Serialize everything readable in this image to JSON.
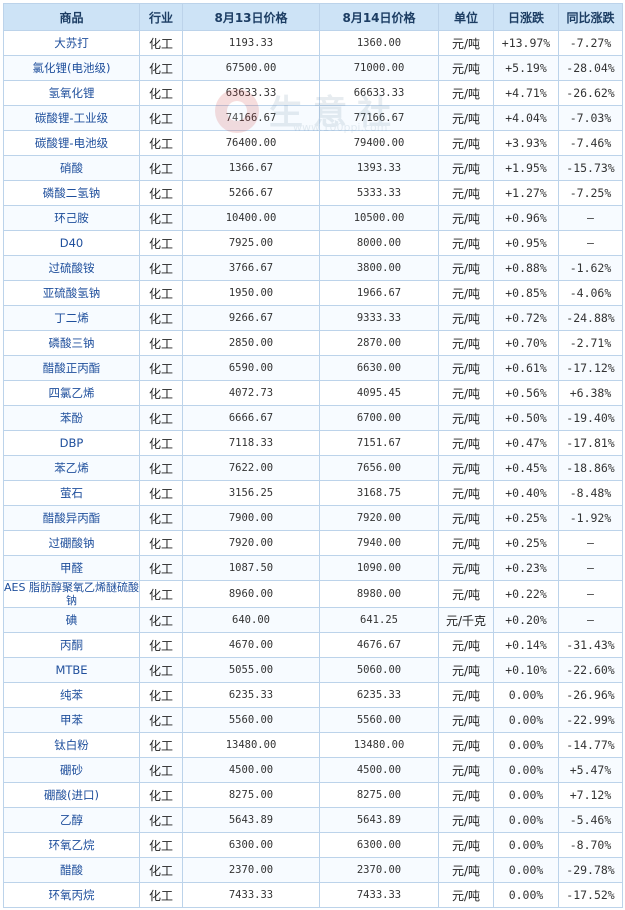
{
  "table": {
    "headers": [
      "商品",
      "行业",
      "8月13日价格",
      "8月14日价格",
      "单位",
      "日涨跌",
      "同比涨跌"
    ],
    "rows": [
      {
        "name": "大苏打",
        "industry": "化工",
        "p13": "1193.33",
        "p14": "1360.00",
        "unit": "元/吨",
        "day": "+13.97%",
        "yoy": "-7.27%"
      },
      {
        "name": "氯化锂(电池级)",
        "industry": "化工",
        "p13": "67500.00",
        "p14": "71000.00",
        "unit": "元/吨",
        "day": "+5.19%",
        "yoy": "-28.04%"
      },
      {
        "name": "氢氧化锂",
        "industry": "化工",
        "p13": "63633.33",
        "p14": "66633.33",
        "unit": "元/吨",
        "day": "+4.71%",
        "yoy": "-26.62%"
      },
      {
        "name": "碳酸锂-工业级",
        "industry": "化工",
        "p13": "74166.67",
        "p14": "77166.67",
        "unit": "元/吨",
        "day": "+4.04%",
        "yoy": "-7.03%"
      },
      {
        "name": "碳酸锂-电池级",
        "industry": "化工",
        "p13": "76400.00",
        "p14": "79400.00",
        "unit": "元/吨",
        "day": "+3.93%",
        "yoy": "-7.46%"
      },
      {
        "name": "硝酸",
        "industry": "化工",
        "p13": "1366.67",
        "p14": "1393.33",
        "unit": "元/吨",
        "day": "+1.95%",
        "yoy": "-15.73%"
      },
      {
        "name": "磷酸二氢钠",
        "industry": "化工",
        "p13": "5266.67",
        "p14": "5333.33",
        "unit": "元/吨",
        "day": "+1.27%",
        "yoy": "-7.25%"
      },
      {
        "name": "环己胺",
        "industry": "化工",
        "p13": "10400.00",
        "p14": "10500.00",
        "unit": "元/吨",
        "day": "+0.96%",
        "yoy": "—"
      },
      {
        "name": "D40",
        "industry": "化工",
        "p13": "7925.00",
        "p14": "8000.00",
        "unit": "元/吨",
        "day": "+0.95%",
        "yoy": "—"
      },
      {
        "name": "过硫酸铵",
        "industry": "化工",
        "p13": "3766.67",
        "p14": "3800.00",
        "unit": "元/吨",
        "day": "+0.88%",
        "yoy": "-1.62%"
      },
      {
        "name": "亚硫酸氢钠",
        "industry": "化工",
        "p13": "1950.00",
        "p14": "1966.67",
        "unit": "元/吨",
        "day": "+0.85%",
        "yoy": "-4.06%"
      },
      {
        "name": "丁二烯",
        "industry": "化工",
        "p13": "9266.67",
        "p14": "9333.33",
        "unit": "元/吨",
        "day": "+0.72%",
        "yoy": "-24.88%"
      },
      {
        "name": "磷酸三钠",
        "industry": "化工",
        "p13": "2850.00",
        "p14": "2870.00",
        "unit": "元/吨",
        "day": "+0.70%",
        "yoy": "-2.71%"
      },
      {
        "name": "醋酸正丙酯",
        "industry": "化工",
        "p13": "6590.00",
        "p14": "6630.00",
        "unit": "元/吨",
        "day": "+0.61%",
        "yoy": "-17.12%"
      },
      {
        "name": "四氯乙烯",
        "industry": "化工",
        "p13": "4072.73",
        "p14": "4095.45",
        "unit": "元/吨",
        "day": "+0.56%",
        "yoy": "+6.38%"
      },
      {
        "name": "苯酚",
        "industry": "化工",
        "p13": "6666.67",
        "p14": "6700.00",
        "unit": "元/吨",
        "day": "+0.50%",
        "yoy": "-19.40%"
      },
      {
        "name": "DBP",
        "industry": "化工",
        "p13": "7118.33",
        "p14": "7151.67",
        "unit": "元/吨",
        "day": "+0.47%",
        "yoy": "-17.81%"
      },
      {
        "name": "苯乙烯",
        "industry": "化工",
        "p13": "7622.00",
        "p14": "7656.00",
        "unit": "元/吨",
        "day": "+0.45%",
        "yoy": "-18.86%"
      },
      {
        "name": "萤石",
        "industry": "化工",
        "p13": "3156.25",
        "p14": "3168.75",
        "unit": "元/吨",
        "day": "+0.40%",
        "yoy": "-8.48%"
      },
      {
        "name": "醋酸异丙酯",
        "industry": "化工",
        "p13": "7900.00",
        "p14": "7920.00",
        "unit": "元/吨",
        "day": "+0.25%",
        "yoy": "-1.92%"
      },
      {
        "name": "过硼酸钠",
        "industry": "化工",
        "p13": "7920.00",
        "p14": "7940.00",
        "unit": "元/吨",
        "day": "+0.25%",
        "yoy": "—"
      },
      {
        "name": "甲醛",
        "industry": "化工",
        "p13": "1087.50",
        "p14": "1090.00",
        "unit": "元/吨",
        "day": "+0.23%",
        "yoy": "—"
      },
      {
        "name": "AES 脂肪醇聚氧乙烯醚硫酸钠",
        "industry": "化工",
        "p13": "8960.00",
        "p14": "8980.00",
        "unit": "元/吨",
        "day": "+0.22%",
        "yoy": "—",
        "wrap": true
      },
      {
        "name": "碘",
        "industry": "化工",
        "p13": "640.00",
        "p14": "641.25",
        "unit": "元/千克",
        "day": "+0.20%",
        "yoy": "—"
      },
      {
        "name": "丙酮",
        "industry": "化工",
        "p13": "4670.00",
        "p14": "4676.67",
        "unit": "元/吨",
        "day": "+0.14%",
        "yoy": "-31.43%"
      },
      {
        "name": "MTBE",
        "industry": "化工",
        "p13": "5055.00",
        "p14": "5060.00",
        "unit": "元/吨",
        "day": "+0.10%",
        "yoy": "-22.60%"
      },
      {
        "name": "纯苯",
        "industry": "化工",
        "p13": "6235.33",
        "p14": "6235.33",
        "unit": "元/吨",
        "day": "0.00%",
        "yoy": "-26.96%"
      },
      {
        "name": "甲苯",
        "industry": "化工",
        "p13": "5560.00",
        "p14": "5560.00",
        "unit": "元/吨",
        "day": "0.00%",
        "yoy": "-22.99%"
      },
      {
        "name": "钛白粉",
        "industry": "化工",
        "p13": "13480.00",
        "p14": "13480.00",
        "unit": "元/吨",
        "day": "0.00%",
        "yoy": "-14.77%"
      },
      {
        "name": "硼砂",
        "industry": "化工",
        "p13": "4500.00",
        "p14": "4500.00",
        "unit": "元/吨",
        "day": "0.00%",
        "yoy": "+5.47%"
      },
      {
        "name": "硼酸(进口)",
        "industry": "化工",
        "p13": "8275.00",
        "p14": "8275.00",
        "unit": "元/吨",
        "day": "0.00%",
        "yoy": "+7.12%"
      },
      {
        "name": "乙醇",
        "industry": "化工",
        "p13": "5643.89",
        "p14": "5643.89",
        "unit": "元/吨",
        "day": "0.00%",
        "yoy": "-5.46%"
      },
      {
        "name": "环氧乙烷",
        "industry": "化工",
        "p13": "6300.00",
        "p14": "6300.00",
        "unit": "元/吨",
        "day": "0.00%",
        "yoy": "-8.70%"
      },
      {
        "name": "醋酸",
        "industry": "化工",
        "p13": "2370.00",
        "p14": "2370.00",
        "unit": "元/吨",
        "day": "0.00%",
        "yoy": "-29.78%"
      },
      {
        "name": "环氧丙烷",
        "industry": "化工",
        "p13": "7433.33",
        "p14": "7433.33",
        "unit": "元/吨",
        "day": "0.00%",
        "yoy": "-17.52%"
      }
    ]
  },
  "watermark": {
    "text": "生意社",
    "url": "www.100ppi.com"
  },
  "colors": {
    "header_bg": "#cde3f6",
    "border": "#bcd3ea",
    "link": "#1f4f9c",
    "up": "#e3001b",
    "down": "#008000"
  }
}
